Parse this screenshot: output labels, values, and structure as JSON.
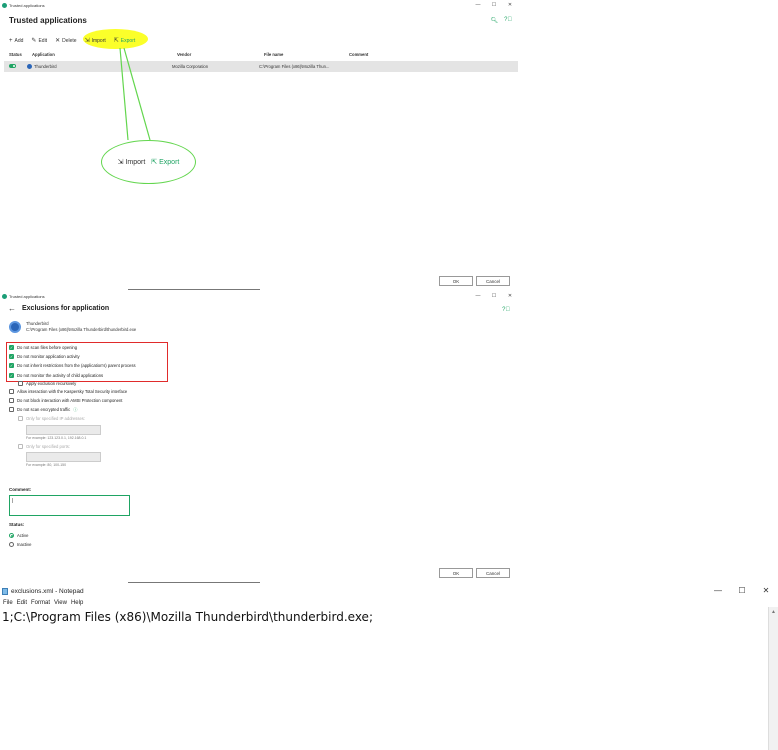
{
  "window1": {
    "title": "Trusted applications",
    "heading": "Trusted applications",
    "header_icons": [
      "search-icon",
      "help-icon"
    ],
    "toolbar": {
      "add": "Add",
      "edit": "Edit",
      "delete": "Delete",
      "import": "Import",
      "export": "Export"
    },
    "columns": [
      "Status",
      "Application",
      "Vendor",
      "File name",
      "Comment"
    ],
    "rows": [
      {
        "status": "on",
        "application": "Thunderbird",
        "vendor": "Mozilla Corporation",
        "file_name": "C:\\Program Files (x86)\\Mozilla Thun...",
        "comment": ""
      }
    ],
    "callout": {
      "import": "Import",
      "export": "Export"
    },
    "ok": "OK",
    "cancel": "Cancel"
  },
  "window2": {
    "title": "Trusted applications",
    "heading": "Exclusions for application",
    "app_name": "Thunderbird",
    "app_path": "C:\\Program Files (x86)\\Mozilla Thunderbird\\thunderbird.exe",
    "options": [
      {
        "label": "Do not scan files before opening",
        "checked": true
      },
      {
        "label": "Do not monitor application activity",
        "checked": true
      },
      {
        "label": "Do not inherit restrictions from the (application's) parent process",
        "checked": true
      },
      {
        "label": "Do not monitor the activity of child applications",
        "checked": true
      }
    ],
    "apply_recursive": "Apply exclusion recursively",
    "allow_interaction": "Allow interaction with the Kaspersky Total Security interface",
    "no_block_amsi": "Do not block interaction with AMSI Protection component",
    "no_scan_encrypted": "Do not scan encrypted traffic",
    "only_ip": "Only for specified IP addresses:",
    "ip_example": "For example: 123.123.0.1, 192.168.0.1",
    "only_ports": "Only for specified ports:",
    "ports_example": "For example: 80, 100-150",
    "comment_label": "Comment:",
    "comment_value": "",
    "status_label": "Status:",
    "status_active": "Active",
    "status_inactive": "Inactive",
    "ok": "OK",
    "cancel": "Cancel"
  },
  "notepad": {
    "title": "exclusions.xml - Notepad",
    "menu": [
      "File",
      "Edit",
      "Format",
      "View",
      "Help"
    ],
    "content": "1;C:\\Program Files (x86)\\Mozilla Thunderbird\\thunderbird.exe;"
  },
  "colors": {
    "accent_green": "#1fa463",
    "highlight_yellow": "#fbff2a",
    "callout_green": "#63d64e",
    "annotation_red": "#e02b2b"
  }
}
